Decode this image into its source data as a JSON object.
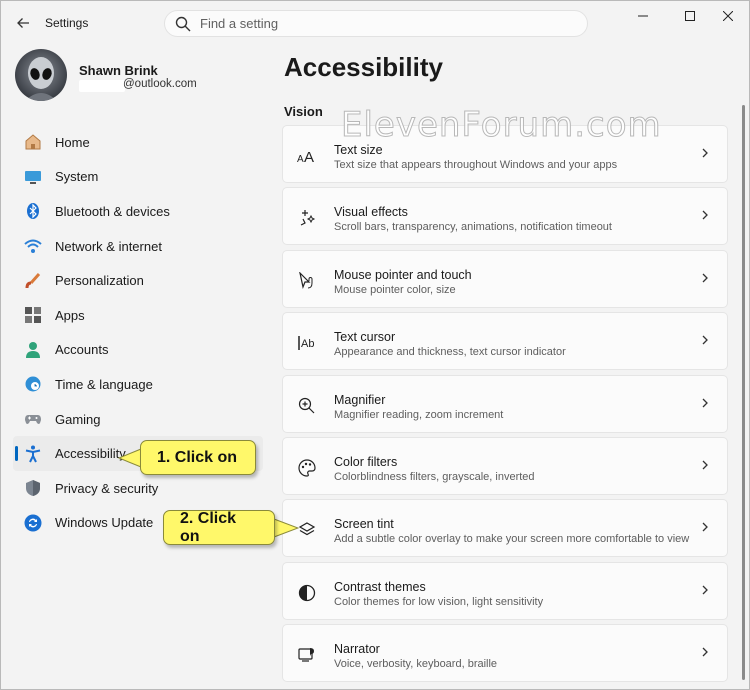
{
  "window": {
    "app_title": "Settings",
    "search_placeholder": "Find a setting"
  },
  "profile": {
    "name": "Shawn Brink",
    "email": "@outlook.com"
  },
  "sidebar": {
    "items": [
      {
        "label": "Home",
        "icon": "home-icon"
      },
      {
        "label": "System",
        "icon": "system-icon"
      },
      {
        "label": "Bluetooth & devices",
        "icon": "bluetooth-icon"
      },
      {
        "label": "Network & internet",
        "icon": "wifi-icon"
      },
      {
        "label": "Personalization",
        "icon": "brush-icon"
      },
      {
        "label": "Apps",
        "icon": "apps-icon"
      },
      {
        "label": "Accounts",
        "icon": "person-icon"
      },
      {
        "label": "Time & language",
        "icon": "globe-clock-icon"
      },
      {
        "label": "Gaming",
        "icon": "gamepad-icon"
      },
      {
        "label": "Accessibility",
        "icon": "accessibility-icon",
        "selected": true
      },
      {
        "label": "Privacy & security",
        "icon": "shield-icon"
      },
      {
        "label": "Windows Update",
        "icon": "update-icon"
      }
    ]
  },
  "main": {
    "title": "Accessibility",
    "section": "Vision",
    "watermark": "ElevenForum.com",
    "cards": [
      {
        "title": "Text size",
        "subtitle": "Text size that appears throughout Windows and your apps",
        "icon": "text-size-icon"
      },
      {
        "title": "Visual effects",
        "subtitle": "Scroll bars, transparency, animations, notification timeout",
        "icon": "sparkle-icon"
      },
      {
        "title": "Mouse pointer and touch",
        "subtitle": "Mouse pointer color, size",
        "icon": "pointer-icon"
      },
      {
        "title": "Text cursor",
        "subtitle": "Appearance and thickness, text cursor indicator",
        "icon": "text-cursor-icon"
      },
      {
        "title": "Magnifier",
        "subtitle": "Magnifier reading, zoom increment",
        "icon": "magnifier-icon"
      },
      {
        "title": "Color filters",
        "subtitle": "Colorblindness filters, grayscale, inverted",
        "icon": "palette-icon"
      },
      {
        "title": "Screen tint",
        "subtitle": "Add a subtle color overlay to make your screen more comfortable to view",
        "icon": "layers-icon"
      },
      {
        "title": "Contrast themes",
        "subtitle": "Color themes for low vision, light sensitivity",
        "icon": "contrast-icon"
      },
      {
        "title": "Narrator",
        "subtitle": "Voice, verbosity, keyboard, braille",
        "icon": "narrator-icon"
      }
    ]
  },
  "callouts": {
    "step1": "1. Click on",
    "step2": "2. Click on"
  },
  "colors": {
    "accent": "#0067c0",
    "callout": "#fff86a",
    "background": "#f3f3f3"
  }
}
